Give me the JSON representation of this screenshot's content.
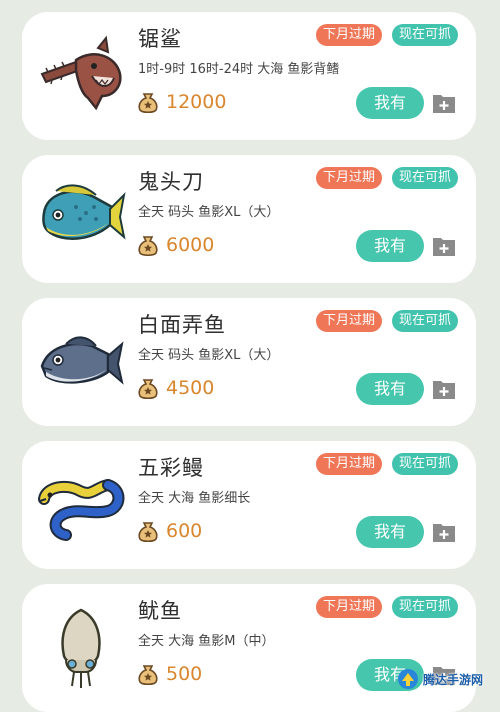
{
  "colors": {
    "background": "#e6ebe4",
    "expire_badge": "#ef7657",
    "available_badge": "#42c3ad",
    "have_button": "#45c6ad",
    "price": "#d9862e"
  },
  "fish": [
    {
      "name": "锯鲨",
      "info": "1时-9时 16时-24时 大海 鱼影背鳍",
      "price": "12000",
      "expire_label": "下月过期",
      "available_label": "现在可抓",
      "have_label": "我有",
      "icon": "saw-shark-icon"
    },
    {
      "name": "鬼头刀",
      "info": "全天 码头 鱼影XL（大）",
      "price": "6000",
      "expire_label": "下月过期",
      "available_label": "现在可抓",
      "have_label": "我有",
      "icon": "mahi-mahi-icon"
    },
    {
      "name": "白面弄鱼",
      "info": "全天 码头 鱼影XL（大）",
      "price": "4500",
      "expire_label": "下月过期",
      "available_label": "现在可抓",
      "have_label": "我有",
      "icon": "giant-trevally-icon"
    },
    {
      "name": "五彩鳗",
      "info": "全天 大海 鱼影细长",
      "price": "600",
      "expire_label": "下月过期",
      "available_label": "现在可抓",
      "have_label": "我有",
      "icon": "ribbon-eel-icon"
    },
    {
      "name": "鱿鱼",
      "info": "全天 大海 鱼影M（中）",
      "price": "500",
      "expire_label": "下月过期",
      "available_label": "现在可抓",
      "have_label": "我有",
      "icon": "squid-icon"
    }
  ],
  "watermark": {
    "text": "腾达手游网"
  }
}
